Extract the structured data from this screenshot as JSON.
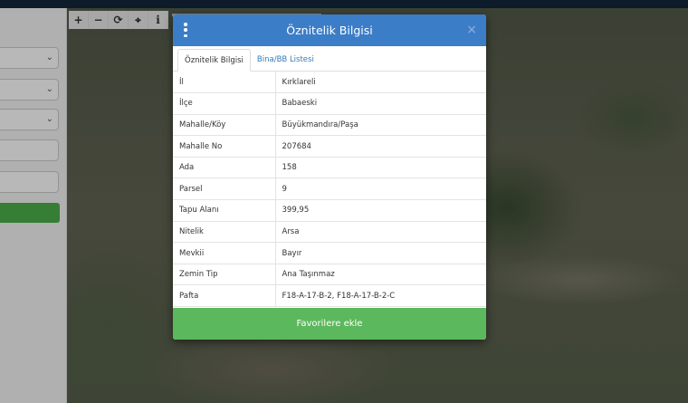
{
  "modal": {
    "title": "Öznitelik Bilgisi",
    "close_label": "×",
    "tabs": [
      {
        "label": "Öznitelik Bilgisi",
        "active": true
      },
      {
        "label": "Bina/BB Listesi",
        "active": false
      }
    ],
    "rows": [
      {
        "key": "İl",
        "value": "Kırklareli"
      },
      {
        "key": "İlçe",
        "value": "Babaeski"
      },
      {
        "key": "Mahalle/Köy",
        "value": "Büyükmandıra/Paşa"
      },
      {
        "key": "Mahalle No",
        "value": "207684"
      },
      {
        "key": "Ada",
        "value": "158"
      },
      {
        "key": "Parsel",
        "value": "9"
      },
      {
        "key": "Tapu Alanı",
        "value": "399,95"
      },
      {
        "key": "Nitelik",
        "value": "Arsa"
      },
      {
        "key": "Mevkii",
        "value": "Bayır"
      },
      {
        "key": "Zemin Tip",
        "value": "Ana Taşınmaz"
      },
      {
        "key": "Pafta",
        "value": "F18-A-17-B-2, F18-A-17-B-2-C"
      }
    ],
    "favorite_button": "Favorilere ekle"
  },
  "toolbar": {
    "zoom_in": "+",
    "zoom_out": "−",
    "refresh": "⟳",
    "locate": "⌖",
    "info": "i"
  },
  "icons": [
    "menu-icon",
    "close-icon",
    "zoom-in-icon",
    "zoom-out-icon",
    "refresh-icon",
    "locate-icon",
    "info-icon",
    "chevron-down-icon"
  ],
  "colors": {
    "header": "#3c7dc7",
    "favorite_button": "#5cb85c",
    "side_button": "#4cae4c",
    "tab_link": "#337ab7"
  }
}
